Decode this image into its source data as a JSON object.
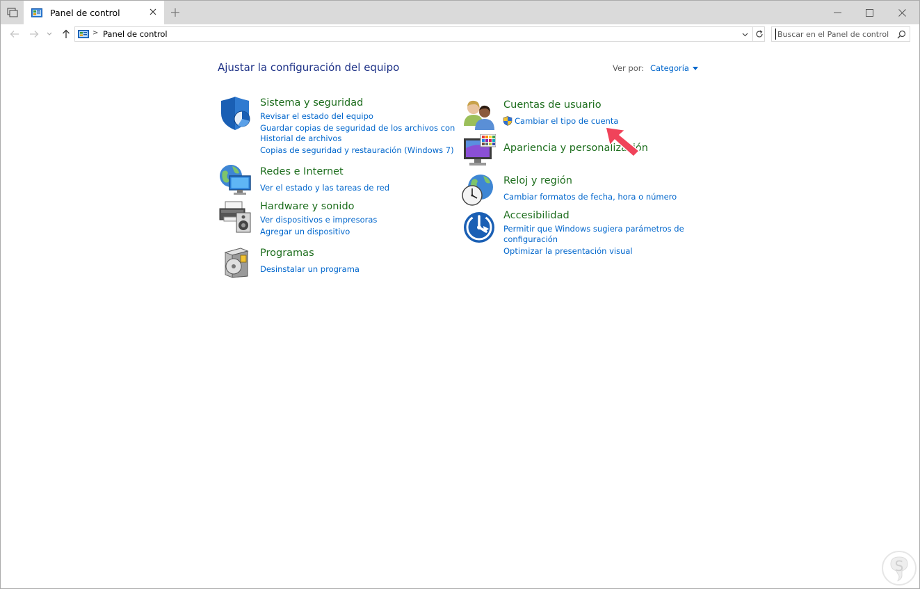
{
  "window": {
    "tab_title": "Panel de control",
    "new_tab_symbol": "+",
    "minimize_symbol": "─",
    "maximize_symbol": "☐",
    "close_symbol": "✕"
  },
  "address": {
    "breadcrumb_sep": ">",
    "path": "Panel de control",
    "search_placeholder": "Buscar en el Panel de control"
  },
  "content": {
    "heading": "Ajustar la configuración del equipo",
    "view_by_label": "Ver por:",
    "view_by_value": "Categoría"
  },
  "categories_left": [
    {
      "title": "Sistema y seguridad",
      "icon": "shield-icon",
      "links": [
        "Revisar el estado del equipo",
        "Guardar copias de seguridad de los archivos con",
        "Historial de archivos",
        "Copias de seguridad y restauración (Windows 7)"
      ]
    },
    {
      "title": "Redes e Internet",
      "icon": "network-globe-icon",
      "links": [
        "Ver el estado y las tareas de red"
      ]
    },
    {
      "title": "Hardware y sonido",
      "icon": "printer-speaker-icon",
      "links": [
        "Ver dispositivos e impresoras",
        "Agregar un dispositivo"
      ]
    },
    {
      "title": "Programas",
      "icon": "programs-disc-icon",
      "links": [
        "Desinstalar un programa"
      ]
    }
  ],
  "categories_right": [
    {
      "title": "Cuentas de usuario",
      "icon": "users-icon",
      "links": [
        "Cambiar el tipo de cuenta"
      ]
    },
    {
      "title": "Apariencia y personalización",
      "icon": "monitor-palette-icon",
      "links": []
    },
    {
      "title": "Reloj y región",
      "icon": "clock-globe-icon",
      "links": [
        "Cambiar formatos de fecha, hora o número"
      ]
    },
    {
      "title": "Accesibilidad",
      "icon": "accessibility-icon",
      "links": [
        "Permitir que Windows sugiera parámetros de",
        "configuración",
        "Optimizar la presentación visual"
      ]
    }
  ],
  "colors": {
    "heading": "#1e3287",
    "category_title": "#1e6e1e",
    "link": "#0066cc",
    "arrow": "#f0435a"
  }
}
